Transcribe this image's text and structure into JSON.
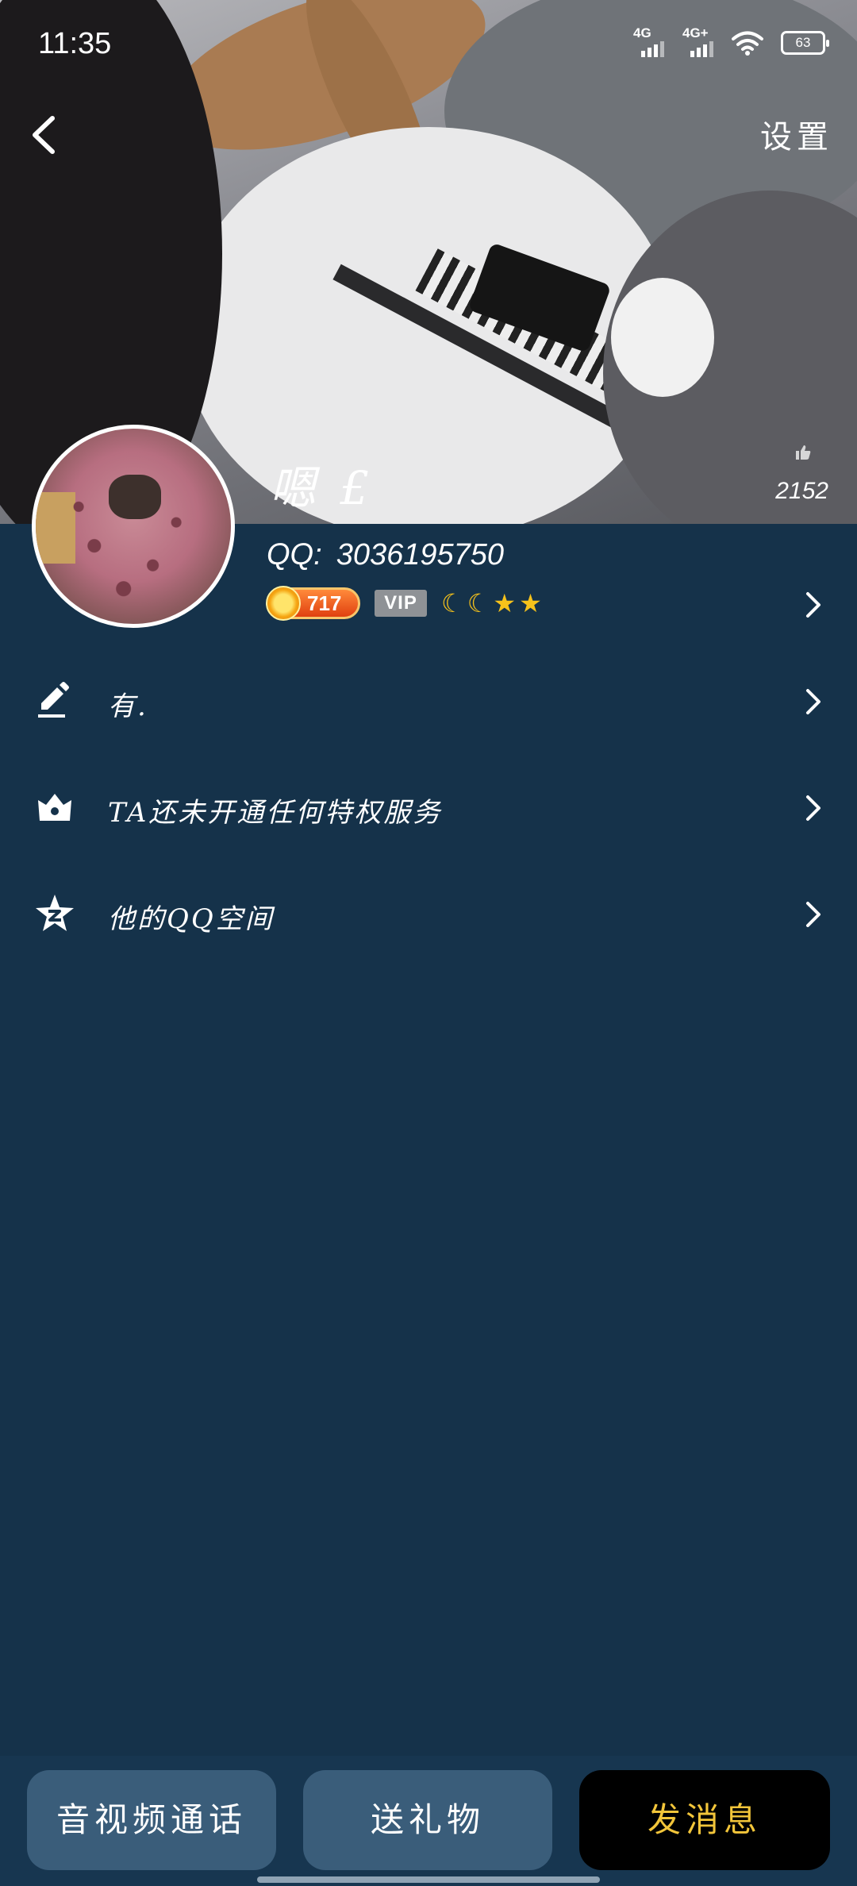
{
  "status_bar": {
    "time": "11:35",
    "signal1": "4G",
    "signal2": "4G+",
    "battery": "63"
  },
  "nav": {
    "settings_label": "设置"
  },
  "profile": {
    "nickname": "嗯 £",
    "likes": "2152",
    "qq_label": "QQ:",
    "qq_number": "3036195750",
    "level": "717",
    "vip_label": "VIP",
    "level_icons": [
      "moon",
      "moon",
      "star",
      "star"
    ]
  },
  "rows": [
    {
      "icon": "edit-icon",
      "label": "有."
    },
    {
      "icon": "crown-icon",
      "label": "TA还未开通任何特权服务"
    },
    {
      "icon": "qzone-star-icon",
      "label": "他的QQ空间"
    }
  ],
  "buttons": {
    "call": "音视频通话",
    "gift": "送礼物",
    "message": "发消息"
  },
  "colors": {
    "background": "#15324a",
    "button": "#3a5d7a",
    "message_button_text": "#f2c53a"
  }
}
